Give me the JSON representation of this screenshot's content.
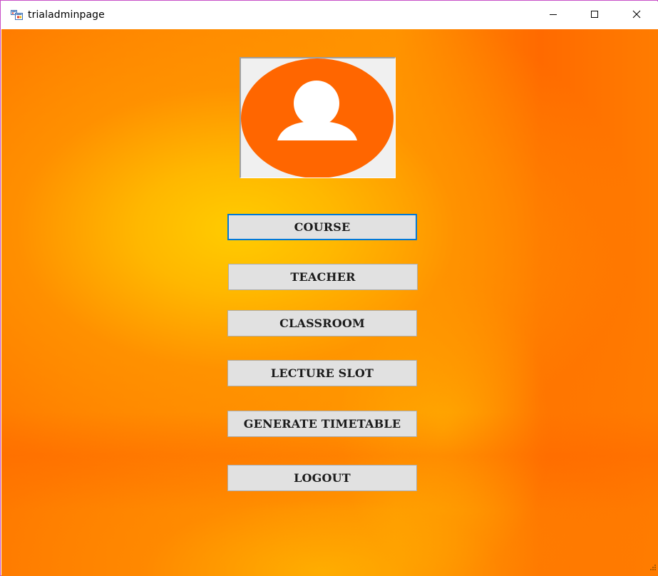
{
  "window": {
    "title": "trialadminpage",
    "icon": "winforms-app-icon"
  },
  "titlebar_buttons": [
    {
      "name": "minimize",
      "icon": "minimize-icon"
    },
    {
      "name": "maximize",
      "icon": "maximize-icon"
    },
    {
      "name": "close",
      "icon": "close-icon"
    }
  ],
  "avatar": {
    "icon": "user-avatar-icon",
    "circle_color": "#ff6600",
    "figure_color": "#ffffff"
  },
  "menu": {
    "course": "COURSE",
    "teacher": "TEACHER",
    "classroom": "CLASSROOM",
    "lecture_slot": "LECTURE SLOT",
    "generate_timetable": "GENERATE TIMETABLE",
    "logout": "LOGOUT"
  },
  "colors": {
    "background_primary": "#ff7a00",
    "background_highlight": "#ffcc00",
    "button_face": "#e1e1e1",
    "focus_border": "#0078d7"
  }
}
